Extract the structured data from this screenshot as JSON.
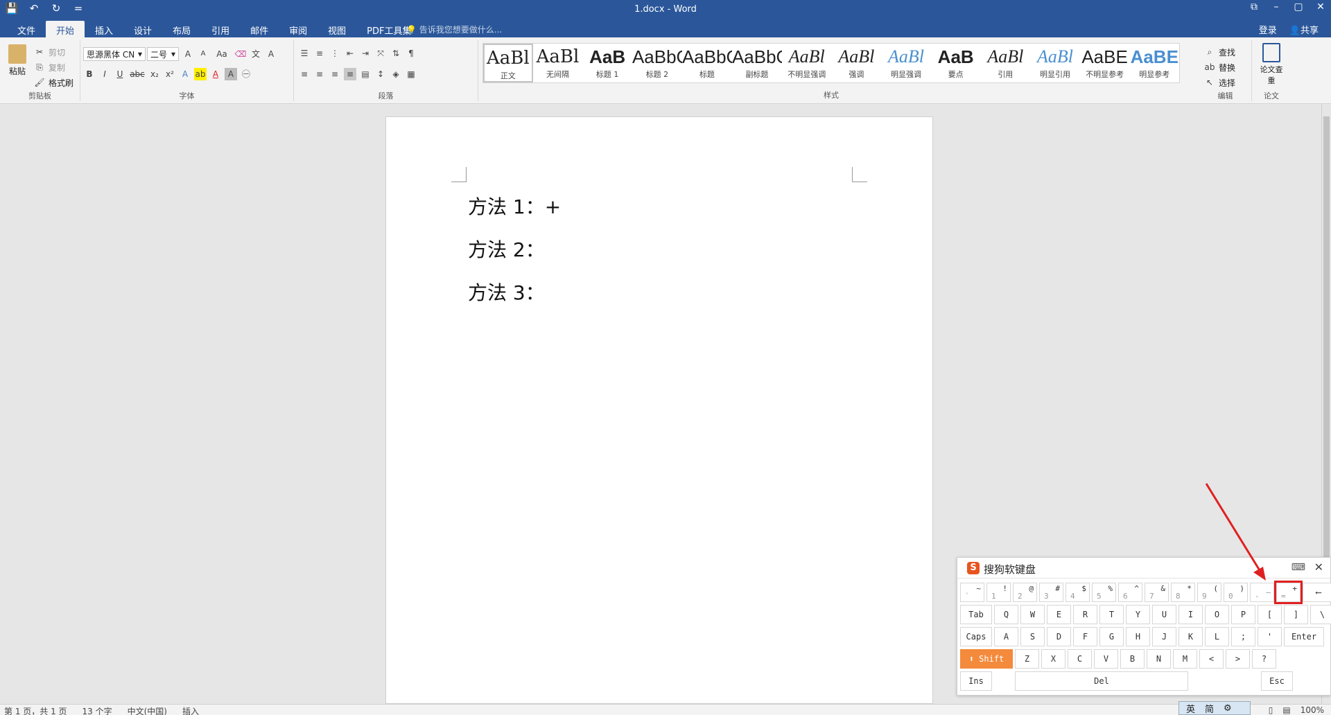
{
  "titlebar": {
    "title": "1.docx - Word",
    "qat": [
      "💾",
      "↶",
      "↻",
      "="
    ],
    "win_controls": [
      "⧉",
      "–",
      "▢",
      "✕"
    ]
  },
  "tabs": {
    "items": [
      "文件",
      "开始",
      "插入",
      "设计",
      "布局",
      "引用",
      "邮件",
      "审阅",
      "视图",
      "PDF工具集"
    ],
    "active": "开始",
    "search_hint": "告诉我您想要做什么...",
    "login": "登录",
    "share": "共享"
  },
  "clipboard": {
    "paste": "粘贴",
    "cut": "剪切",
    "copy": "复制",
    "format_painter": "格式刷",
    "label": "剪贴板"
  },
  "font": {
    "name": "思源黑体 CN",
    "size": "二号",
    "grow": "A",
    "shrink": "A",
    "case": "Aa",
    "bold": "B",
    "italic": "I",
    "underline": "U",
    "strike": "abc",
    "sub": "x₂",
    "sup": "x²",
    "label": "字体"
  },
  "paragraph": {
    "label": "段落"
  },
  "styles": {
    "label": "样式",
    "items": [
      {
        "sample": "AaBl",
        "name": "正文"
      },
      {
        "sample": "AaBl",
        "name": "无间隔"
      },
      {
        "sample": "AaB",
        "name": "标题 1"
      },
      {
        "sample": "AaBbC",
        "name": "标题 2"
      },
      {
        "sample": "AaBbC",
        "name": "标题"
      },
      {
        "sample": "AaBbC",
        "name": "副标题"
      },
      {
        "sample": "AaBl",
        "name": "不明显强调"
      },
      {
        "sample": "AaBl",
        "name": "强调"
      },
      {
        "sample": "AaBl",
        "name": "明显强调"
      },
      {
        "sample": "AaB",
        "name": "要点"
      },
      {
        "sample": "AaBl",
        "name": "引用"
      },
      {
        "sample": "AaBl",
        "name": "明显引用"
      },
      {
        "sample": "AaBE",
        "name": "不明显参考"
      },
      {
        "sample": "AaBE",
        "name": "明显参考"
      }
    ]
  },
  "editing": {
    "find": "查找",
    "replace": "替换",
    "select": "选择",
    "label": "编辑"
  },
  "paper": {
    "check": "论文查重",
    "label": "论文"
  },
  "document": {
    "lines": [
      "方法 1：+",
      "方法 2：",
      "方法 3："
    ]
  },
  "status": {
    "page": "第 1 页，共 1 页",
    "words": "13 个字",
    "lang": "中文(中国)",
    "mode": "插入",
    "zoom": "100%"
  },
  "softkeyboard": {
    "title": "搜狗软键盘",
    "row1": [
      {
        "up": "~",
        "lo": "`"
      },
      {
        "up": "!",
        "lo": "1"
      },
      {
        "up": "@",
        "lo": "2"
      },
      {
        "up": "#",
        "lo": "3"
      },
      {
        "up": "$",
        "lo": "4"
      },
      {
        "up": "%",
        "lo": "5"
      },
      {
        "up": "^",
        "lo": "6"
      },
      {
        "up": "&",
        "lo": "7"
      },
      {
        "up": "*",
        "lo": "8"
      },
      {
        "up": "(",
        "lo": "9"
      },
      {
        "up": ")",
        "lo": "0"
      },
      {
        "up": "_",
        "lo": "-"
      },
      {
        "up": "+",
        "lo": "="
      }
    ],
    "backspace": "⟵",
    "row2": [
      "Tab",
      "Q",
      "W",
      "E",
      "R",
      "T",
      "Y",
      "U",
      "I",
      "O",
      "P",
      "[",
      "]",
      "\\"
    ],
    "row3": [
      "Caps",
      "A",
      "S",
      "D",
      "F",
      "G",
      "H",
      "J",
      "K",
      "L",
      ";",
      "'",
      "Enter"
    ],
    "row4": [
      "⬆ Shift",
      "Z",
      "X",
      "C",
      "V",
      "B",
      "N",
      "M",
      "<",
      ">",
      "?"
    ],
    "row5": [
      "Ins",
      "Del",
      "Esc"
    ],
    "lang_bar": [
      "英",
      "简",
      "⚙"
    ]
  }
}
